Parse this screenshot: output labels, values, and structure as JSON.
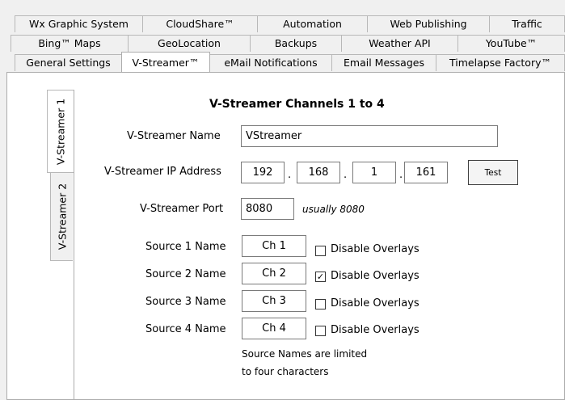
{
  "tabs": {
    "row1": [
      "Wx Graphic System",
      "CloudShare™",
      "Automation",
      "Web Publishing",
      "Traffic"
    ],
    "row2": [
      "Bing™ Maps",
      "GeoLocation",
      "Backups",
      "Weather API",
      "YouTube™"
    ],
    "row3": [
      "General Settings",
      "V-Streamer™",
      "eMail Notifications",
      "Email Messages",
      "Timelapse Factory™"
    ],
    "active": "V-Streamer™"
  },
  "side_tabs": [
    "V-Streamer 1",
    "V-Streamer 2"
  ],
  "section_title": "V-Streamer Channels 1 to 4",
  "name": {
    "label": "V-Streamer Name",
    "value": "VStreamer"
  },
  "ip": {
    "label": "V-Streamer IP Address",
    "octets": [
      "192",
      "168",
      "1",
      "161"
    ],
    "separator": ".",
    "test_label": "Test"
  },
  "port": {
    "label": "V-Streamer Port",
    "value": "8080",
    "hint": "usually 8080"
  },
  "sources": [
    {
      "label": "Source 1 Name",
      "value": "Ch 1",
      "disable_label": "Disable Overlays",
      "checked": false
    },
    {
      "label": "Source 2 Name",
      "value": "Ch 2",
      "disable_label": "Disable Overlays",
      "checked": true
    },
    {
      "label": "Source 3 Name",
      "value": "Ch 3",
      "disable_label": "Disable Overlays",
      "checked": false
    },
    {
      "label": "Source 4 Name",
      "value": "Ch 4",
      "disable_label": "Disable Overlays",
      "checked": false
    }
  ],
  "note": {
    "line1": "Source Names are limited",
    "line2": "to four characters"
  }
}
